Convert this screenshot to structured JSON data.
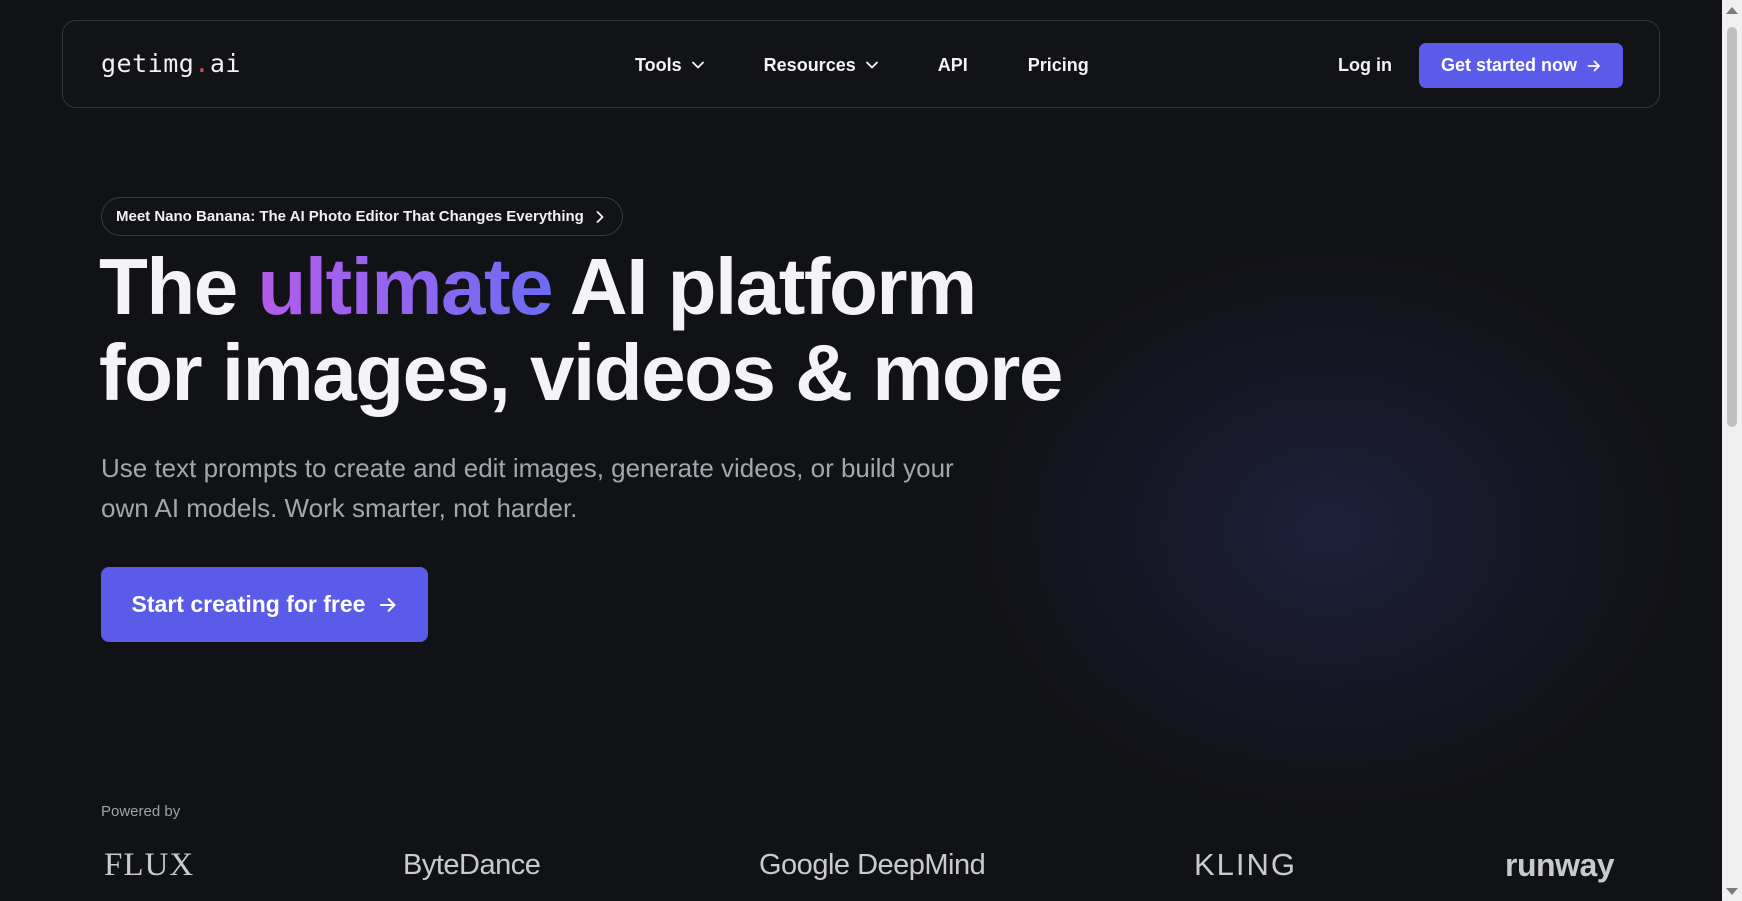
{
  "nav": {
    "logo_main": "getimg",
    "logo_dot": ".",
    "logo_tld": "ai",
    "links": [
      {
        "label": "Tools",
        "has_dropdown": true
      },
      {
        "label": "Resources",
        "has_dropdown": true
      },
      {
        "label": "API",
        "has_dropdown": false
      },
      {
        "label": "Pricing",
        "has_dropdown": false
      }
    ],
    "login_label": "Log in",
    "cta_label": "Get started now"
  },
  "hero": {
    "announcement": "Meet Nano Banana: The AI Photo Editor That Changes Everything",
    "headline_part1": "The ",
    "headline_highlight": "ultimate",
    "headline_part2": " AI platform",
    "headline_line2": "for images, videos & more",
    "subtitle": "Use text prompts to create and edit images, generate videos, or build your own AI models. Work smarter, not harder.",
    "cta_label": "Start creating for free"
  },
  "powered_by": {
    "label": "Powered by",
    "brands": [
      "FLUX",
      "ByteDance",
      "Google DeepMind",
      "KLING",
      "runway"
    ]
  },
  "colors": {
    "background": "#111216",
    "accent": "#5b5bea",
    "gradient_start": "#b35ce8",
    "gradient_end": "#6c6cf2",
    "logo_dot": "#e5484d"
  },
  "icons": [
    "chevron-down-icon",
    "arrow-right-icon",
    "chevron-right-icon"
  ]
}
